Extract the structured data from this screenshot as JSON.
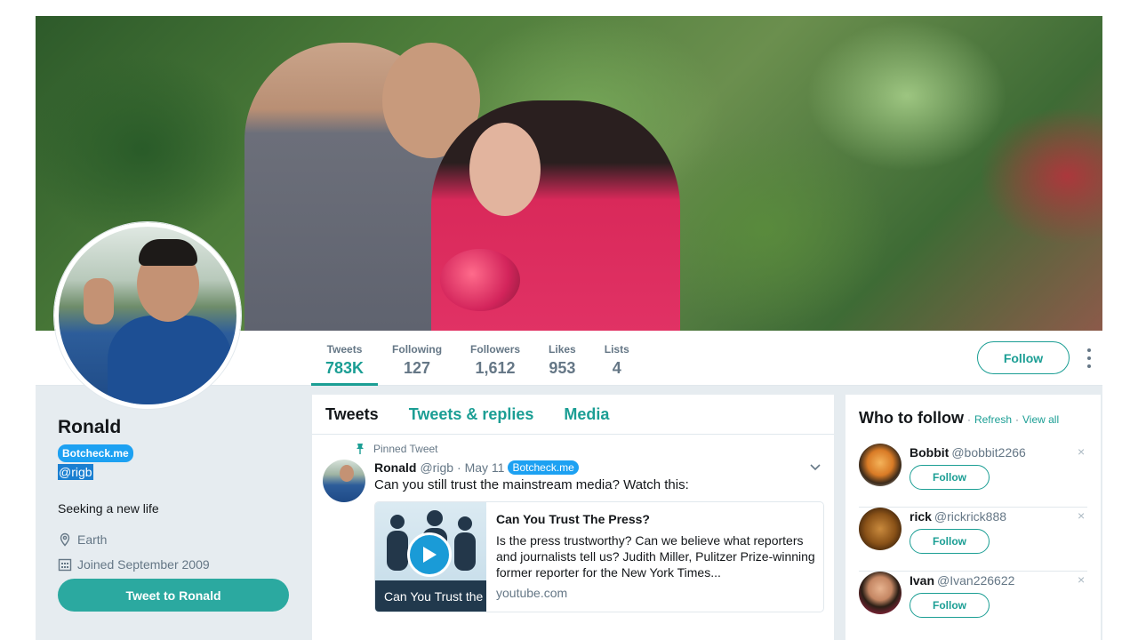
{
  "banner": {
    "title": ""
  },
  "profile": {
    "name": "Ronald",
    "badge": "Botcheck.me",
    "handle": "@rigb",
    "bio": "Seeking a new life",
    "location": "Earth",
    "joined": "Joined September 2009",
    "tweet_to_label": "Tweet to Ronald",
    "icons": {
      "location": "location-pin-icon",
      "joined": "calendar-icon"
    }
  },
  "stats": [
    {
      "label": "Tweets",
      "value": "783K"
    },
    {
      "label": "Following",
      "value": "127"
    },
    {
      "label": "Followers",
      "value": "1,612"
    },
    {
      "label": "Likes",
      "value": "953"
    },
    {
      "label": "Lists",
      "value": "4"
    }
  ],
  "header_actions": {
    "follow_label": "Follow",
    "more_icon": "vertical-dots-icon"
  },
  "timeline": {
    "tabs": [
      "Tweets",
      "Tweets & replies",
      "Media"
    ],
    "pinned_label": "Pinned Tweet",
    "tweet": {
      "name": "Ronald",
      "handle": "@rigb",
      "date": "· May 11",
      "badge": "Botcheck.me",
      "text": "Can you still trust the mainstream media? Watch this:",
      "card": {
        "thumb_caption": "Can You Trust the",
        "title": "Can You Trust The Press?",
        "description": "Is the press trustworthy? Can we believe what reporters and journalists tell us? Judith Miller, Pulitzer Prize-winning former reporter for the New York Times...",
        "domain": "youtube.com"
      }
    }
  },
  "who_to_follow": {
    "title": "Who to follow",
    "separator": "·",
    "refresh": "Refresh",
    "view_all": "View all",
    "close_glyph": "×",
    "follow_label": "Follow",
    "accounts": [
      {
        "name": "Bobbit",
        "handle": "@bobbit2266"
      },
      {
        "name": "rick",
        "handle": "@rickrick888"
      },
      {
        "name": "Ivan",
        "handle": "@Ivan226622"
      }
    ]
  },
  "colors": {
    "accent": "#1b9e94",
    "badge": "#1da1f2",
    "button_fill": "#2ba9a0"
  }
}
